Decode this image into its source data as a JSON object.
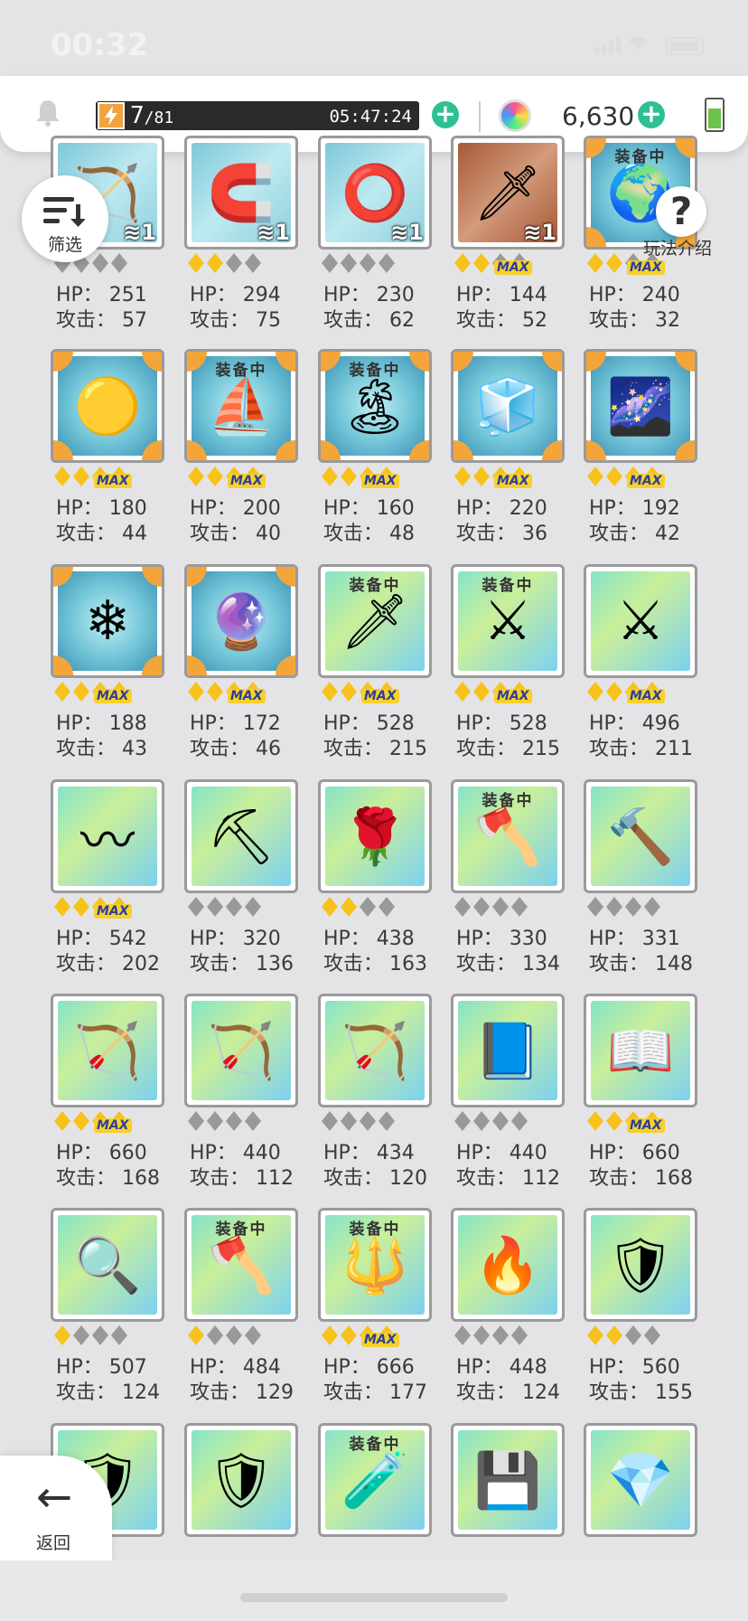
{
  "status_bar": {
    "time": "00:32"
  },
  "top_bar": {
    "energy_current": "7",
    "energy_max": "/81",
    "energy_timer": "05:47:24",
    "gems": "6,630"
  },
  "filter": {
    "label": "筛选"
  },
  "help": {
    "label": "玩法介绍",
    "symbol": "?"
  },
  "back": {
    "label": "返回",
    "symbol": "←"
  },
  "labels": {
    "hp": "HP：",
    "atk": "攻击：",
    "equipped": "装备中",
    "max": "MAX"
  },
  "items": [
    {
      "icon": "bow-icon",
      "glyph": "🏹",
      "bg": "blue",
      "stars": 0,
      "max": false,
      "hp": "251",
      "atk": "57",
      "equipped": false,
      "count": "1"
    },
    {
      "icon": "horseshoe-icon",
      "glyph": "🧲",
      "bg": "blue",
      "stars": 2,
      "max": false,
      "hp": "294",
      "atk": "75",
      "equipped": false,
      "count": "1"
    },
    {
      "icon": "ring-icon",
      "glyph": "⭕",
      "bg": "blue",
      "stars": 0,
      "max": false,
      "hp": "230",
      "atk": "62",
      "equipped": false,
      "count": "1"
    },
    {
      "icon": "sword-icon",
      "glyph": "🗡",
      "bg": "brown",
      "stars": 2,
      "max": true,
      "hp": "144",
      "atk": "52",
      "equipped": false,
      "count": "1"
    },
    {
      "icon": "globe-icon",
      "glyph": "🌍",
      "bg": "orange",
      "stars": 2,
      "max": true,
      "hp": "240",
      "atk": "32",
      "equipped": true,
      "count": ""
    },
    {
      "icon": "sand-globe-icon",
      "glyph": "🟡",
      "bg": "orange",
      "stars": 4,
      "max": true,
      "hp": "180",
      "atk": "44",
      "equipped": false,
      "count": ""
    },
    {
      "icon": "ship-globe-icon",
      "glyph": "⛵",
      "bg": "orange",
      "stars": 4,
      "max": true,
      "hp": "200",
      "atk": "40",
      "equipped": true,
      "count": ""
    },
    {
      "icon": "island-globe-icon",
      "glyph": "🏝",
      "bg": "orange",
      "stars": 4,
      "max": true,
      "hp": "160",
      "atk": "48",
      "equipped": true,
      "count": ""
    },
    {
      "icon": "ice-globe-icon",
      "glyph": "🧊",
      "bg": "orange",
      "stars": 4,
      "max": true,
      "hp": "220",
      "atk": "36",
      "equipped": false,
      "count": ""
    },
    {
      "icon": "night-globe-icon",
      "glyph": "🌌",
      "bg": "orange",
      "stars": 4,
      "max": true,
      "hp": "192",
      "atk": "42",
      "equipped": false,
      "count": ""
    },
    {
      "icon": "snow-globe-icon",
      "glyph": "❄",
      "bg": "orange",
      "stars": 4,
      "max": true,
      "hp": "188",
      "atk": "43",
      "equipped": false,
      "count": ""
    },
    {
      "icon": "dark-globe-icon",
      "glyph": "🔮",
      "bg": "orange",
      "stars": 4,
      "max": true,
      "hp": "172",
      "atk": "46",
      "equipped": false,
      "count": ""
    },
    {
      "icon": "rainbow-sword-icon",
      "glyph": "🗡",
      "bg": "rainbow",
      "stars": 4,
      "max": true,
      "hp": "528",
      "atk": "215",
      "equipped": true,
      "count": ""
    },
    {
      "icon": "blue-sword-icon",
      "glyph": "⚔",
      "bg": "rainbow",
      "stars": 4,
      "max": true,
      "hp": "528",
      "atk": "215",
      "equipped": true,
      "count": ""
    },
    {
      "icon": "crossed-spears-icon",
      "glyph": "⚔",
      "bg": "rainbow",
      "stars": 4,
      "max": true,
      "hp": "496",
      "atk": "211",
      "equipped": false,
      "count": ""
    },
    {
      "icon": "whip-icon",
      "glyph": "〰",
      "bg": "rainbow",
      "stars": 4,
      "max": true,
      "hp": "542",
      "atk": "202",
      "equipped": false,
      "count": ""
    },
    {
      "icon": "pickaxe-icon",
      "glyph": "⛏",
      "bg": "rainbow",
      "stars": 0,
      "max": false,
      "hp": "320",
      "atk": "136",
      "equipped": false,
      "count": ""
    },
    {
      "icon": "rose-staff-icon",
      "glyph": "🌹",
      "bg": "rainbow",
      "stars": 2,
      "max": false,
      "hp": "438",
      "atk": "163",
      "equipped": false,
      "count": ""
    },
    {
      "icon": "axe-icon",
      "glyph": "🪓",
      "bg": "rainbow",
      "stars": 0,
      "max": false,
      "hp": "330",
      "atk": "134",
      "equipped": true,
      "count": ""
    },
    {
      "icon": "hammer-icon",
      "glyph": "🔨",
      "bg": "rainbow",
      "stars": 0,
      "max": false,
      "hp": "331",
      "atk": "148",
      "equipped": false,
      "count": ""
    },
    {
      "icon": "red-bow-icon",
      "glyph": "🏹",
      "bg": "rainbow",
      "stars": 4,
      "max": true,
      "hp": "660",
      "atk": "168",
      "equipped": false,
      "count": ""
    },
    {
      "icon": "dark-bow-icon",
      "glyph": "🏹",
      "bg": "rainbow",
      "stars": 0,
      "max": false,
      "hp": "440",
      "atk": "112",
      "equipped": false,
      "count": ""
    },
    {
      "icon": "gold-bow-icon",
      "glyph": "🏹",
      "bg": "rainbow",
      "stars": 0,
      "max": false,
      "hp": "434",
      "atk": "120",
      "equipped": false,
      "count": ""
    },
    {
      "icon": "tome-icon",
      "glyph": "📘",
      "bg": "rainbow",
      "stars": 0,
      "max": false,
      "hp": "440",
      "atk": "112",
      "equipped": false,
      "count": ""
    },
    {
      "icon": "spellbook-icon",
      "glyph": "📖",
      "bg": "rainbow",
      "stars": 4,
      "max": true,
      "hp": "660",
      "atk": "168",
      "equipped": false,
      "count": ""
    },
    {
      "icon": "magnifier-staff-icon",
      "glyph": "🔍",
      "bg": "rainbow",
      "stars": 1,
      "max": false,
      "hp": "507",
      "atk": "124",
      "equipped": false,
      "count": ""
    },
    {
      "icon": "crystal-axe-icon",
      "glyph": "🪓",
      "bg": "rainbow",
      "stars": 1,
      "max": false,
      "hp": "484",
      "atk": "129",
      "equipped": true,
      "count": ""
    },
    {
      "icon": "gold-scepter-icon",
      "glyph": "🔱",
      "bg": "rainbow",
      "stars": 4,
      "max": true,
      "hp": "666",
      "atk": "177",
      "equipped": true,
      "count": ""
    },
    {
      "icon": "fire-mace-icon",
      "glyph": "🔥",
      "bg": "rainbow",
      "stars": 0,
      "max": false,
      "hp": "448",
      "atk": "124",
      "equipped": false,
      "count": ""
    },
    {
      "icon": "brain-shield-icon",
      "glyph": "🛡",
      "bg": "rainbow",
      "stars": 2,
      "max": false,
      "hp": "560",
      "atk": "155",
      "equipped": false,
      "count": ""
    },
    {
      "icon": "gold-shield-icon",
      "glyph": "🛡",
      "bg": "rainbow",
      "stars": null,
      "max": false,
      "hp": "",
      "atk": "",
      "equipped": false,
      "count": ""
    },
    {
      "icon": "crest-shield-icon",
      "glyph": "🛡",
      "bg": "rainbow",
      "stars": null,
      "max": false,
      "hp": "",
      "atk": "",
      "equipped": false,
      "count": ""
    },
    {
      "icon": "potion-icon",
      "glyph": "🧪",
      "bg": "rainbow",
      "stars": null,
      "max": false,
      "hp": "",
      "atk": "",
      "equipped": true,
      "count": ""
    },
    {
      "icon": "sd-card-icon",
      "glyph": "💾",
      "bg": "rainbow",
      "stars": null,
      "max": false,
      "hp": "",
      "atk": "",
      "equipped": false,
      "count": ""
    },
    {
      "icon": "amulet-icon",
      "glyph": "💎",
      "bg": "rainbow",
      "stars": null,
      "max": false,
      "hp": "",
      "atk": "",
      "equipped": false,
      "count": ""
    }
  ]
}
